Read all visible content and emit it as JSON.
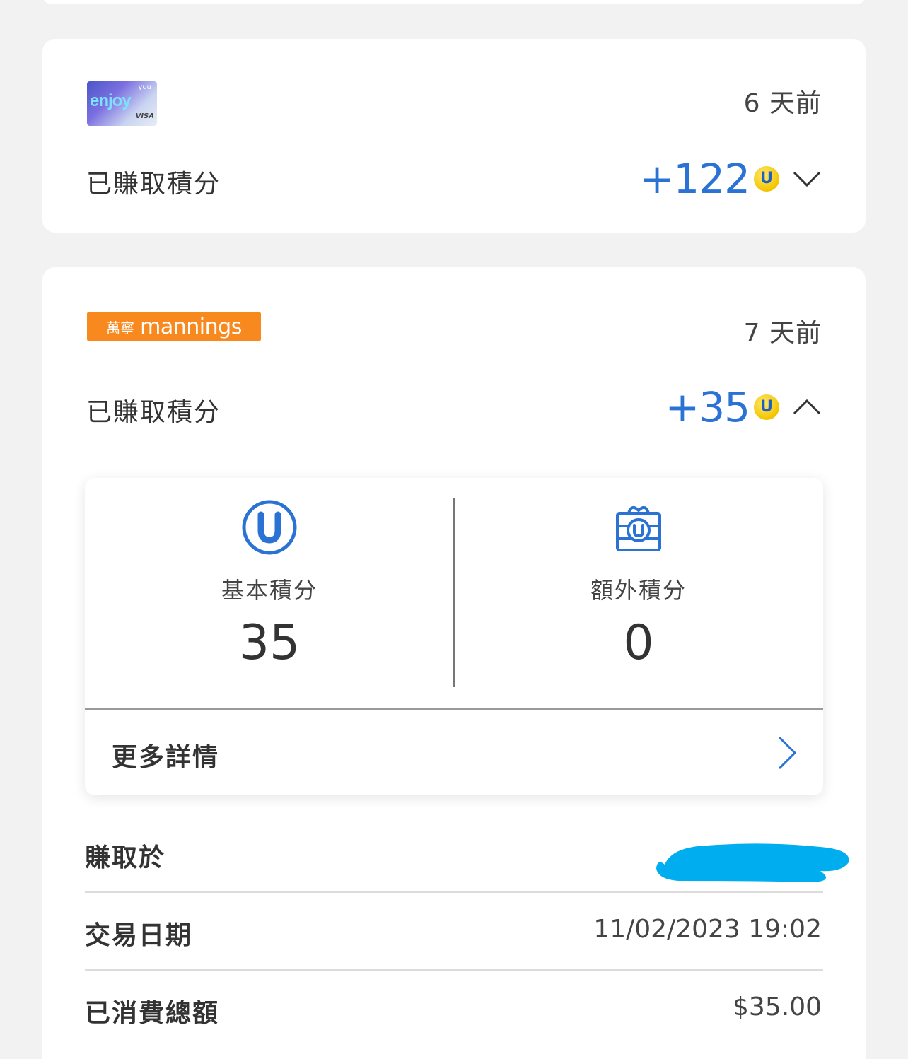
{
  "transactions": [
    {
      "merchant_logo": "enjoy-visa-card",
      "time_ago": "6 天前",
      "earned_label": "已賺取積分",
      "points": "+122",
      "coin_symbol": "U",
      "expand_icon": "chevron-down-icon"
    },
    {
      "merchant_logo_zh": "萬寧",
      "merchant_logo_en": "mannings",
      "time_ago": "7 天前",
      "earned_label": "已賺取積分",
      "points": "+35",
      "coin_symbol": "U",
      "expand_icon": "chevron-up-icon",
      "breakdown": {
        "basic": {
          "label": "基本積分",
          "value": "35",
          "icon": "yuu-points-icon"
        },
        "extra": {
          "label": "額外積分",
          "value": "0",
          "icon": "gift-points-icon"
        },
        "more_details": "更多詳情"
      },
      "details": [
        {
          "label": "賺取於",
          "value": ""
        },
        {
          "label": "交易日期",
          "value": "11/02/2023 19:02"
        },
        {
          "label": "已消費總額",
          "value": "$35.00"
        }
      ]
    }
  ],
  "colors": {
    "points_blue": "#2a72d4",
    "mannings_orange": "#f7891f",
    "coin_yellow": "#f3c500",
    "redaction": "#00aef0"
  }
}
